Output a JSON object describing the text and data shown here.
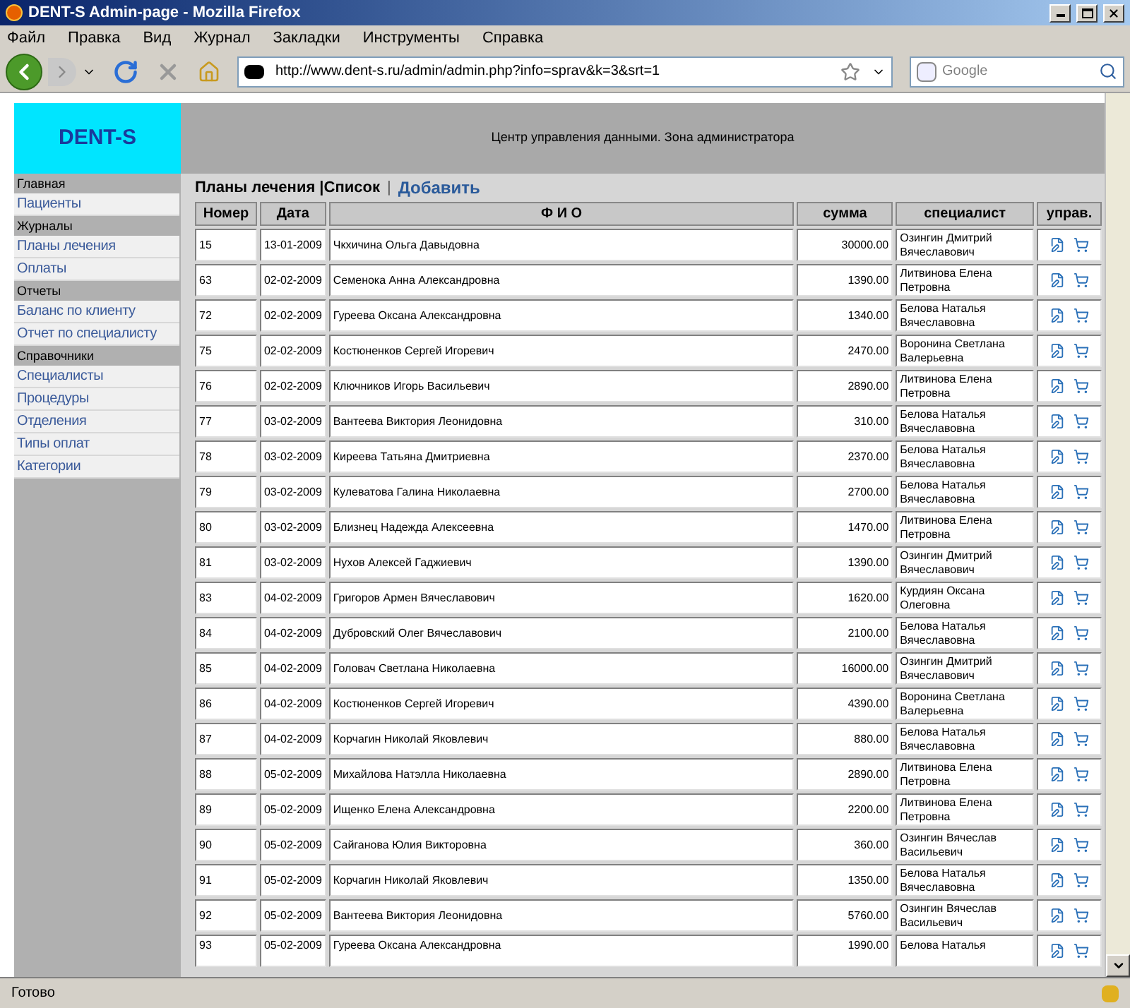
{
  "window": {
    "title": "DENT-S Admin-page - Mozilla Firefox"
  },
  "menu": [
    "Файл",
    "Правка",
    "Вид",
    "Журнал",
    "Закладки",
    "Инструменты",
    "Справка"
  ],
  "toolbar": {
    "url": "http://www.dent-s.ru/admin/admin.php?info=sprav&k=3&srt=1",
    "search_placeholder": "Google"
  },
  "page": {
    "logo": "DENT-S",
    "banner": "Центр управления данными. Зона администратора",
    "sidebar": [
      {
        "title": "Главная",
        "items": [
          {
            "label": "Пациенты"
          }
        ]
      },
      {
        "title": "Журналы",
        "items": [
          {
            "label": "Планы лечения"
          },
          {
            "label": "Оплаты"
          }
        ]
      },
      {
        "title": "Отчеты",
        "items": [
          {
            "label": "Баланс по клиенту"
          },
          {
            "label": "Отчет по специалисту"
          }
        ]
      },
      {
        "title": "Справочники",
        "items": [
          {
            "label": "Специалисты"
          },
          {
            "label": "Процедуры"
          },
          {
            "label": "Отделения"
          },
          {
            "label": "Типы оплат"
          },
          {
            "label": "Категории"
          }
        ]
      }
    ],
    "heading": "Планы лечения |Список",
    "divider": "|",
    "add_link": "Добавить",
    "table": {
      "columns": [
        "Номер",
        "Дата",
        "Ф И О",
        "сумма",
        "специалист",
        "управ."
      ],
      "rows": [
        [
          "15",
          "13-01-2009",
          "Чкхичина Ольга Давыдовна",
          "30000.00",
          "Озингин Дмитрий Вячеславович"
        ],
        [
          "63",
          "02-02-2009",
          "Семенока Анна Александровна",
          "1390.00",
          "Литвинова Елена Петровна"
        ],
        [
          "72",
          "02-02-2009",
          "Гуреева Оксана Александровна",
          "1340.00",
          "Белова Наталья Вячеславовна"
        ],
        [
          "75",
          "02-02-2009",
          "Костюненков Сергей Игоревич",
          "2470.00",
          "Воронина Светлана Валерьевна"
        ],
        [
          "76",
          "02-02-2009",
          "Ключников Игорь Васильевич",
          "2890.00",
          "Литвинова Елена Петровна"
        ],
        [
          "77",
          "03-02-2009",
          "Вантеева Виктория Леонидовна",
          "310.00",
          "Белова Наталья Вячеславовна"
        ],
        [
          "78",
          "03-02-2009",
          "Киреева Татьяна Дмитриевна",
          "2370.00",
          "Белова Наталья Вячеславовна"
        ],
        [
          "79",
          "03-02-2009",
          "Кулеватова Галина Николаевна",
          "2700.00",
          "Белова Наталья Вячеславовна"
        ],
        [
          "80",
          "03-02-2009",
          "Близнец Надежда Алексеевна",
          "1470.00",
          "Литвинова Елена Петровна"
        ],
        [
          "81",
          "03-02-2009",
          "Нухов Алексей Гаджиевич",
          "1390.00",
          "Озингин Дмитрий Вячеславович"
        ],
        [
          "83",
          "04-02-2009",
          "Григоров Армен Вячеславович",
          "1620.00",
          "Курдиян Оксана Олеговна"
        ],
        [
          "84",
          "04-02-2009",
          "Дубровский Олег Вячеславович",
          "2100.00",
          "Белова Наталья Вячеславовна"
        ],
        [
          "85",
          "04-02-2009",
          "Головач Светлана Николаевна",
          "16000.00",
          "Озингин Дмитрий Вячеславович"
        ],
        [
          "86",
          "04-02-2009",
          "Костюненков Сергей Игоревич",
          "4390.00",
          "Воронина Светлана Валерьевна"
        ],
        [
          "87",
          "04-02-2009",
          "Корчагин Николай Яковлевич",
          "880.00",
          "Белова Наталья Вячеславовна"
        ],
        [
          "88",
          "05-02-2009",
          "Михайлова Натэлла Николаевна",
          "2890.00",
          "Литвинова Елена Петровна"
        ],
        [
          "89",
          "05-02-2009",
          "Ищенко Елена Александровна",
          "2200.00",
          "Литвинова Елена Петровна"
        ],
        [
          "90",
          "05-02-2009",
          "Сайганова Юлия Викторовна",
          "360.00",
          "Озингин Вячеслав Васильевич"
        ],
        [
          "91",
          "05-02-2009",
          "Корчагин Николай Яковлевич",
          "1350.00",
          "Белова Наталья Вячеславовна"
        ],
        [
          "92",
          "05-02-2009",
          "Вантеева Виктория Леонидовна",
          "5760.00",
          "Озингин Вячеслав Васильевич"
        ],
        [
          "93",
          "05-02-2009",
          "Гуреева Оксана Александровна",
          "1990.00",
          "Белова Наталья"
        ]
      ]
    }
  },
  "status_bar": "Готово"
}
